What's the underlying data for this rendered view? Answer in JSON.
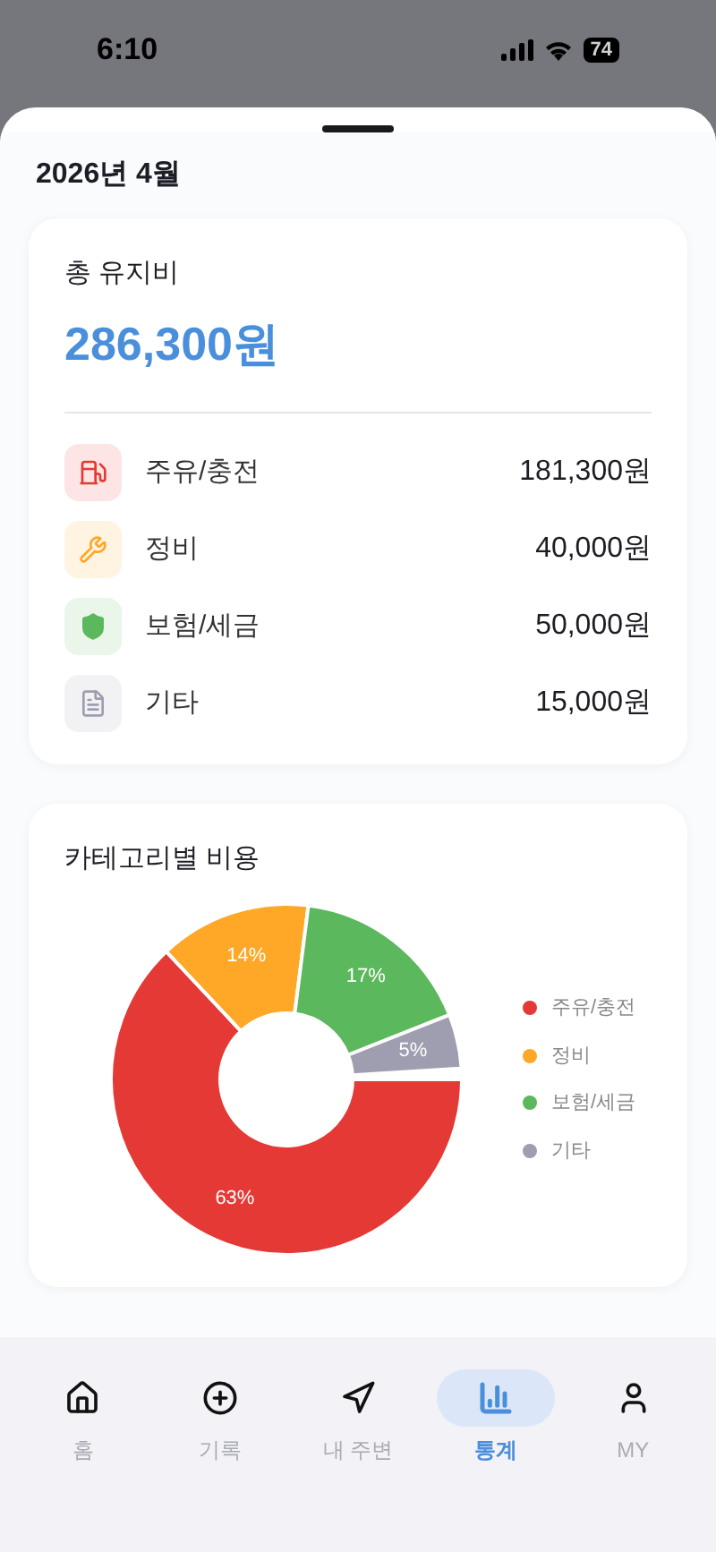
{
  "status_bar": {
    "time": "6:10",
    "battery": "74"
  },
  "header": {
    "title": "2026년 4월"
  },
  "summary": {
    "title": "총 유지비",
    "total": "286,300원",
    "items": [
      {
        "kind": "fuel",
        "label": "주유/충전",
        "amount": "181,300원",
        "color": "#e53935"
      },
      {
        "kind": "repair",
        "label": "정비",
        "amount": "40,000원",
        "color": "#ffa726"
      },
      {
        "kind": "insurance",
        "label": "보험/세금",
        "amount": "50,000원",
        "color": "#5cb85c"
      },
      {
        "kind": "other",
        "label": "기타",
        "amount": "15,000원",
        "color": "#9e9eb0"
      }
    ]
  },
  "category_chart": {
    "title": "카테고리별 비용",
    "chart_data": {
      "type": "donut",
      "categories": [
        "주유/충전",
        "정비",
        "보험/세금",
        "기타"
      ],
      "values": [
        63,
        14,
        17,
        5
      ],
      "colors": [
        "#e53935",
        "#ffa726",
        "#5cb85c",
        "#9e9eb0"
      ],
      "value_labels": [
        "63%",
        "14%",
        "17%",
        "5%"
      ]
    }
  },
  "nav": [
    {
      "kind": "home",
      "label": "홈",
      "selected": false
    },
    {
      "kind": "add",
      "label": "기록",
      "selected": false
    },
    {
      "kind": "nearby",
      "label": "내 주변",
      "selected": false
    },
    {
      "kind": "stats",
      "label": "통계",
      "selected": true
    },
    {
      "kind": "my",
      "label": "MY",
      "selected": false
    }
  ]
}
